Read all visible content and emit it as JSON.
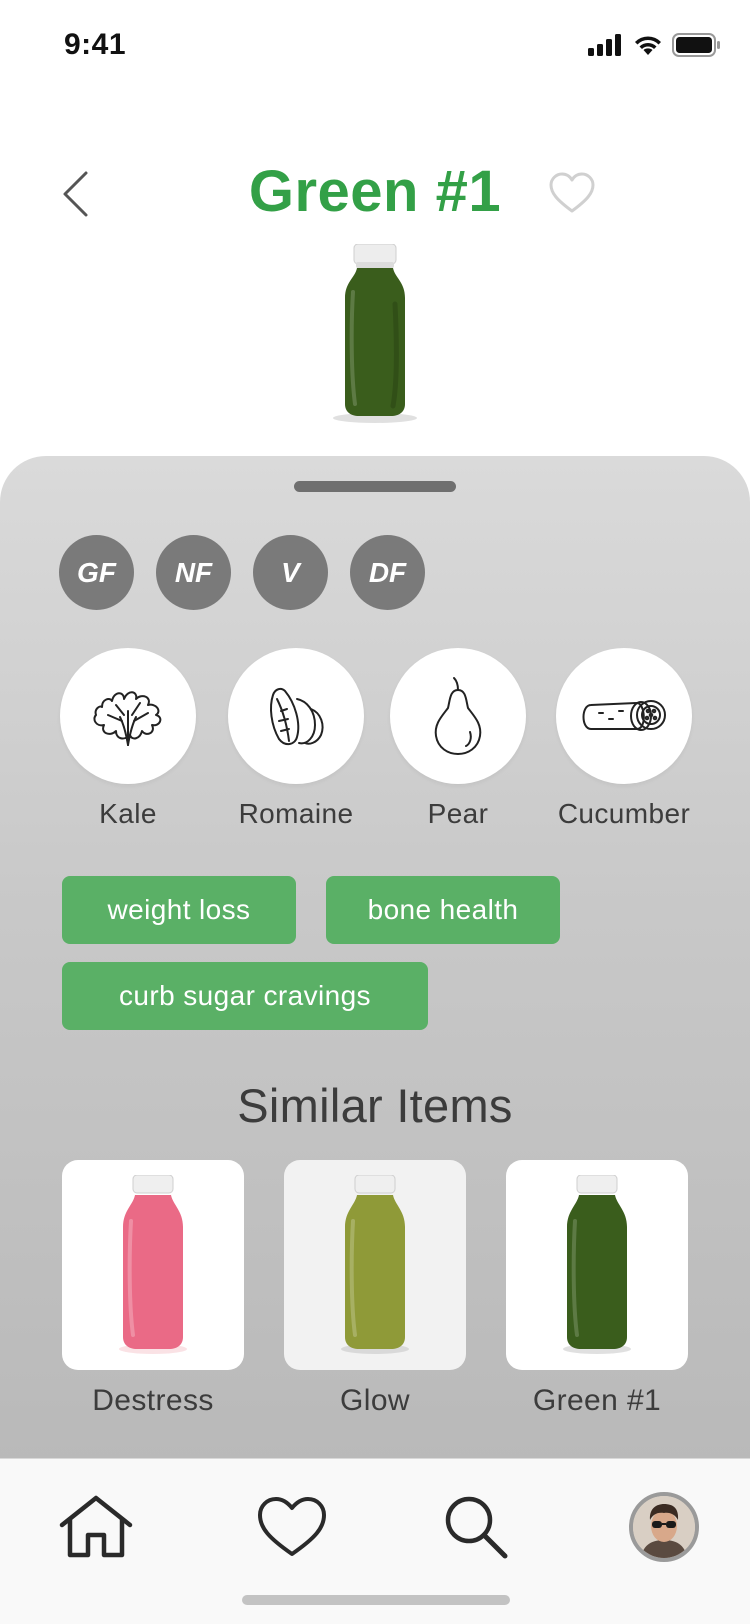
{
  "status_bar": {
    "time": "9:41"
  },
  "header": {
    "title": "Green #1"
  },
  "badges": [
    "GF",
    "NF",
    "V",
    "DF"
  ],
  "ingredients": [
    {
      "label": "Kale",
      "icon": "kale-icon"
    },
    {
      "label": "Romaine",
      "icon": "romaine-icon"
    },
    {
      "label": "Pear",
      "icon": "pear-icon"
    },
    {
      "label": "Cucumber",
      "icon": "cucumber-icon"
    }
  ],
  "tags": [
    "weight loss",
    "bone health",
    "curb sugar cravings"
  ],
  "similar": {
    "title": "Similar Items",
    "items": [
      {
        "label": "Destress",
        "color": "#ea6a86"
      },
      {
        "label": "Glow",
        "color": "#8f9a38"
      },
      {
        "label": "Green #1",
        "color": "#3a5d1c"
      }
    ]
  },
  "colors": {
    "accent": "#33a047",
    "tag": "#5ab066",
    "badge": "#7a7a7a",
    "hero_bottle": "#3a5d1c"
  },
  "tabbar": {
    "items": [
      "home-icon",
      "heart-icon",
      "search-icon",
      "avatar"
    ]
  }
}
